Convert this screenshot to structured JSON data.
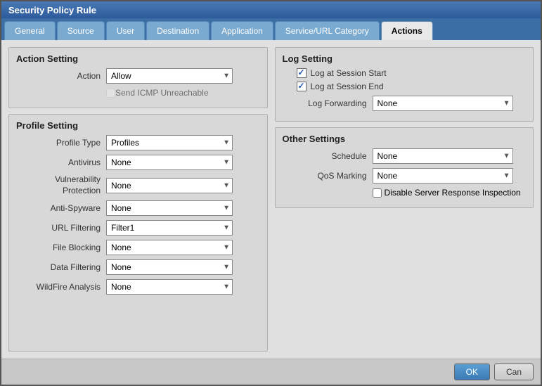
{
  "dialog": {
    "title": "Security Policy Rule"
  },
  "tabs": {
    "items": [
      {
        "label": "General",
        "active": false
      },
      {
        "label": "Source",
        "active": false
      },
      {
        "label": "User",
        "active": false
      },
      {
        "label": "Destination",
        "active": false
      },
      {
        "label": "Application",
        "active": false
      },
      {
        "label": "Service/URL Category",
        "active": false
      },
      {
        "label": "Actions",
        "active": true
      }
    ]
  },
  "action_setting": {
    "title": "Action Setting",
    "action_label": "Action",
    "action_value": "Allow",
    "send_icmp_label": "Send ICMP Unreachable",
    "send_icmp_disabled": true
  },
  "profile_setting": {
    "title": "Profile Setting",
    "profile_type_label": "Profile Type",
    "profile_type_value": "Profiles",
    "antivirus_label": "Antivirus",
    "antivirus_value": "None",
    "vuln_label": "Vulnerability Protection",
    "vuln_value": "None",
    "antispyware_label": "Anti-Spyware",
    "antispyware_value": "None",
    "url_label": "URL Filtering",
    "url_value": "Filter1",
    "file_blocking_label": "File Blocking",
    "file_blocking_value": "None",
    "data_filtering_label": "Data Filtering",
    "data_filtering_value": "None",
    "wildfire_label": "WildFire Analysis",
    "wildfire_value": "None"
  },
  "log_setting": {
    "title": "Log Setting",
    "log_session_start_label": "Log at Session Start",
    "log_session_start_checked": true,
    "log_session_end_label": "Log at Session End",
    "log_session_end_checked": true,
    "log_forwarding_label": "Log Forwarding",
    "log_forwarding_value": "None"
  },
  "other_settings": {
    "title": "Other Settings",
    "schedule_label": "Schedule",
    "schedule_value": "None",
    "qos_label": "QoS Marking",
    "qos_value": "None",
    "disable_server_label": "Disable Server Response Inspection"
  },
  "footer": {
    "ok_label": "OK",
    "cancel_label": "Can"
  }
}
